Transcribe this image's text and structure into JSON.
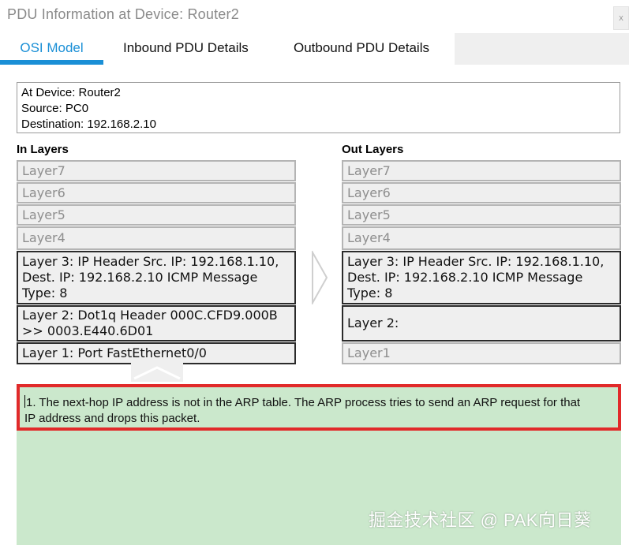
{
  "window": {
    "title": "PDU Information at Device: Router2",
    "close_label": "x"
  },
  "tabs": [
    {
      "label": "OSI Model",
      "active": true
    },
    {
      "label": "Inbound PDU Details",
      "active": false
    },
    {
      "label": "Outbound PDU Details",
      "active": false
    }
  ],
  "device_info": {
    "at_device": "At Device: Router2",
    "source": "Source: PC0",
    "destination": "Destination: 192.168.2.10"
  },
  "in_layers": {
    "header": "In Layers",
    "layer7": "Layer7",
    "layer6": "Layer6",
    "layer5": "Layer5",
    "layer4": "Layer4",
    "layer3_line1": "Layer 3: IP Header Src. IP: 192.168.1.10,",
    "layer3_line2": "Dest. IP: 192.168.2.10 ICMP Message",
    "layer3_line3": "Type: 8",
    "layer2_line1": "Layer 2: Dot1q Header 000C.CFD9.000B",
    "layer2_line2": ">> 0003.E440.6D01",
    "layer1": "Layer 1: Port FastEthernet0/0"
  },
  "out_layers": {
    "header": "Out Layers",
    "layer7": "Layer7",
    "layer6": "Layer6",
    "layer5": "Layer5",
    "layer4": "Layer4",
    "layer3_line1": "Layer 3: IP Header Src. IP: 192.168.1.10,",
    "layer3_line2": "Dest. IP: 192.168.2.10 ICMP Message",
    "layer3_line3": "Type: 8",
    "layer2": "Layer 2:",
    "layer1": "Layer1"
  },
  "message": {
    "line1": "1. The next-hop IP address is not in the ARP table. The ARP process tries to send an ARP request for that",
    "line2": "IP address and drops this packet."
  },
  "watermark": "掘金技术社区 @ PAK向日葵",
  "colors": {
    "accent": "#1a8fd6",
    "highlight_border": "#e12a2a",
    "message_bg": "#cbe8cc",
    "layer_bg": "#efefef"
  },
  "icons": {
    "right_arrow": "arrow-right-icon",
    "up_arrow": "arrow-up-icon"
  }
}
